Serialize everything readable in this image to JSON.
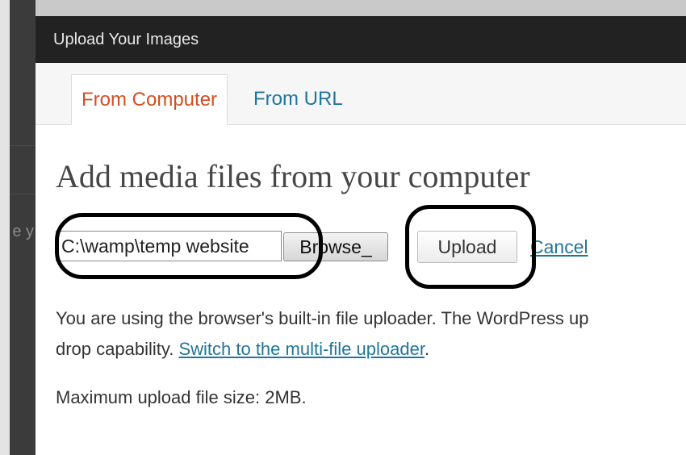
{
  "background": {
    "peek_text": "e y"
  },
  "modal": {
    "title": "Upload Your Images",
    "tabs": [
      {
        "label": "From Computer",
        "active": true
      },
      {
        "label": "From URL",
        "active": false
      }
    ],
    "heading": "Add media files from your computer",
    "file_input_value": "C:\\wamp\\temp website",
    "browse_label": "Browse_",
    "upload_label": "Upload",
    "cancel_label": "Cancel",
    "info_line1": "You are using the browser's built-in file uploader. The WordPress up",
    "info_line2_prefix": "drop capability. ",
    "switch_link": "Switch to the multi-file uploader",
    "info_line2_suffix": ".",
    "max_size_text": "Maximum upload file size: 2MB."
  },
  "colors": {
    "titlebar": "#222222",
    "active_tab_text": "#d54e21",
    "link": "#21759b",
    "annotation_marker": "#000000"
  }
}
